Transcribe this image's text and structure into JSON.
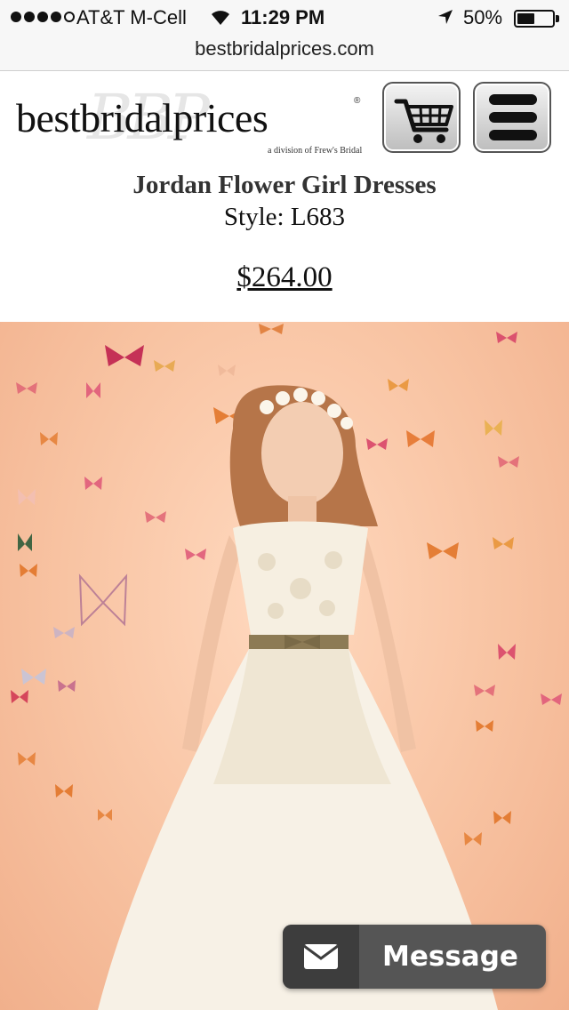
{
  "status_bar": {
    "carrier": "AT&T M-Cell",
    "time": "11:29 PM",
    "battery_percent": "50%",
    "battery_level": 0.5,
    "signal_bars_filled": 4,
    "signal_bars_total": 5
  },
  "browser": {
    "url": "bestbridalprices.com"
  },
  "header": {
    "logo_text": "bestbridalprices",
    "logo_registered": "®",
    "logo_monogram": "BBP",
    "logo_subtitle": "a division of Frew's Bridal",
    "cart_icon": "cart-icon",
    "menu_icon": "hamburger-icon"
  },
  "product": {
    "brand_title": "Jordan Flower Girl Dresses",
    "style": "Style: L683",
    "price": "$264.00"
  },
  "message_button": {
    "label": "Message",
    "icon": "envelope-icon"
  }
}
